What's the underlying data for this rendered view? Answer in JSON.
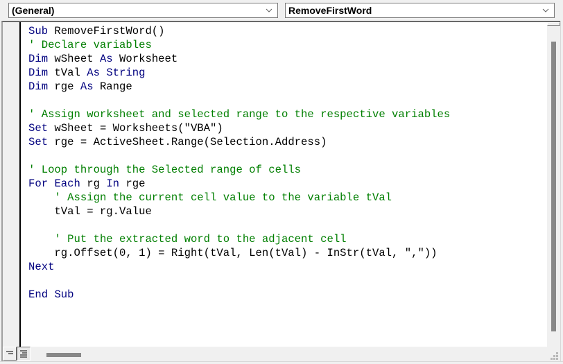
{
  "toolbar": {
    "object_combo": {
      "value": "(General)",
      "icon": "chevron-down-icon"
    },
    "procedure_combo": {
      "value": "RemoveFirstWord",
      "icon": "chevron-down-icon"
    }
  },
  "editor": {
    "colors": {
      "keyword": "#00007F",
      "comment": "#007F00",
      "text": "#000000"
    },
    "lines": [
      [
        {
          "t": "Sub",
          "c": "kw"
        },
        {
          "t": " RemoveFirstWord()",
          "c": ""
        }
      ],
      [
        {
          "t": "' Declare variables",
          "c": "cm"
        }
      ],
      [
        {
          "t": "Dim",
          "c": "kw"
        },
        {
          "t": " wSheet ",
          "c": ""
        },
        {
          "t": "As",
          "c": "kw"
        },
        {
          "t": " Worksheet",
          "c": ""
        }
      ],
      [
        {
          "t": "Dim",
          "c": "kw"
        },
        {
          "t": " tVal ",
          "c": ""
        },
        {
          "t": "As",
          "c": "kw"
        },
        {
          "t": " ",
          "c": ""
        },
        {
          "t": "String",
          "c": "kw"
        }
      ],
      [
        {
          "t": "Dim",
          "c": "kw"
        },
        {
          "t": " rge ",
          "c": ""
        },
        {
          "t": "As",
          "c": "kw"
        },
        {
          "t": " Range",
          "c": ""
        }
      ],
      [],
      [
        {
          "t": "' Assign worksheet and selected range to the respective variables",
          "c": "cm"
        }
      ],
      [
        {
          "t": "Set",
          "c": "kw"
        },
        {
          "t": " wSheet = Worksheets(\"VBA\")",
          "c": ""
        }
      ],
      [
        {
          "t": "Set",
          "c": "kw"
        },
        {
          "t": " rge = ActiveSheet.Range(Selection.Address)",
          "c": ""
        }
      ],
      [],
      [
        {
          "t": "' Loop through the Selected range of cells",
          "c": "cm"
        }
      ],
      [
        {
          "t": "For",
          "c": "kw"
        },
        {
          "t": " ",
          "c": ""
        },
        {
          "t": "Each",
          "c": "kw"
        },
        {
          "t": " rg ",
          "c": ""
        },
        {
          "t": "In",
          "c": "kw"
        },
        {
          "t": " rge",
          "c": ""
        }
      ],
      [
        {
          "t": "    ",
          "c": ""
        },
        {
          "t": "' Assign the current cell value to the variable tVal",
          "c": "cm"
        }
      ],
      [
        {
          "t": "    tVal = rg.Value",
          "c": ""
        }
      ],
      [],
      [
        {
          "t": "    ",
          "c": ""
        },
        {
          "t": "' Put the extracted word to the adjacent cell",
          "c": "cm"
        }
      ],
      [
        {
          "t": "    rg.Offset(0, 1) = Right(tVal, Len(tVal) - InStr(tVal, \",\"))",
          "c": ""
        }
      ],
      [
        {
          "t": "Next",
          "c": "kw"
        }
      ],
      [],
      [
        {
          "t": "End",
          "c": "kw"
        },
        {
          "t": " ",
          "c": ""
        },
        {
          "t": "Sub",
          "c": "kw"
        }
      ]
    ]
  },
  "footer": {
    "procedure_view_icon": "procedure-view-icon",
    "full_module_view_icon": "full-module-view-icon"
  }
}
